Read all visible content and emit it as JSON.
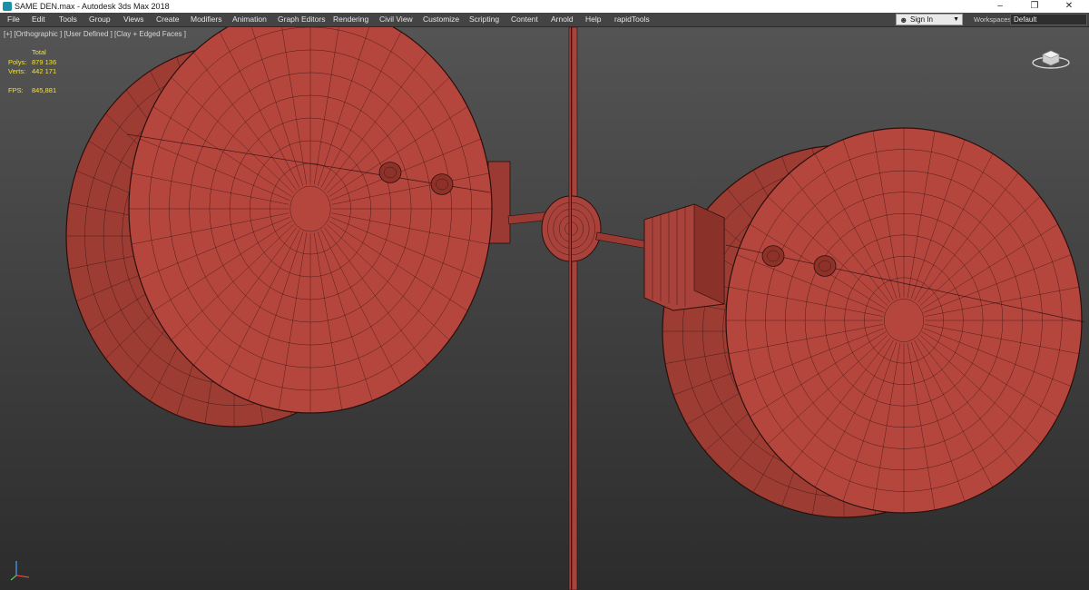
{
  "window": {
    "title": "SAME DEN.max - Autodesk 3ds Max 2018",
    "controls": [
      "–",
      "❐",
      "✕"
    ]
  },
  "menu": {
    "items": [
      "File",
      "Edit",
      "Tools",
      "Group",
      "Views",
      "Create",
      "Modifiers",
      "Animation",
      "Graph Editors",
      "Rendering",
      "Civil View",
      "Customize",
      "Scripting",
      "Content",
      "Arnold",
      "Help",
      "rapidTools"
    ],
    "signin_label": "Sign In",
    "workspaces_label": "Workspaces:",
    "workspaces_value": "Default"
  },
  "viewport": {
    "label": "[+] [Orthographic ] [User Defined ] [Clay + Edged Faces ]",
    "stats": {
      "total_label": "Total",
      "polys_label": "Polys:",
      "polys_value": "879 136",
      "verts_label": "Verts:",
      "verts_value": "442 171",
      "fps_label": "FPS:",
      "fps_value": "845,881"
    },
    "background_top": "#545454",
    "background_bottom": "#2c2c2c",
    "clay_color": "#b5463d",
    "wire_color": "#2a0f0c",
    "stats_color": "#f0e040"
  },
  "icons": {
    "app": "3ds-max-app-icon",
    "user": "user-icon",
    "caret": "chevron-down-icon",
    "gizmo": "axis-tripod-icon",
    "viewcube": "viewcube-icon"
  }
}
